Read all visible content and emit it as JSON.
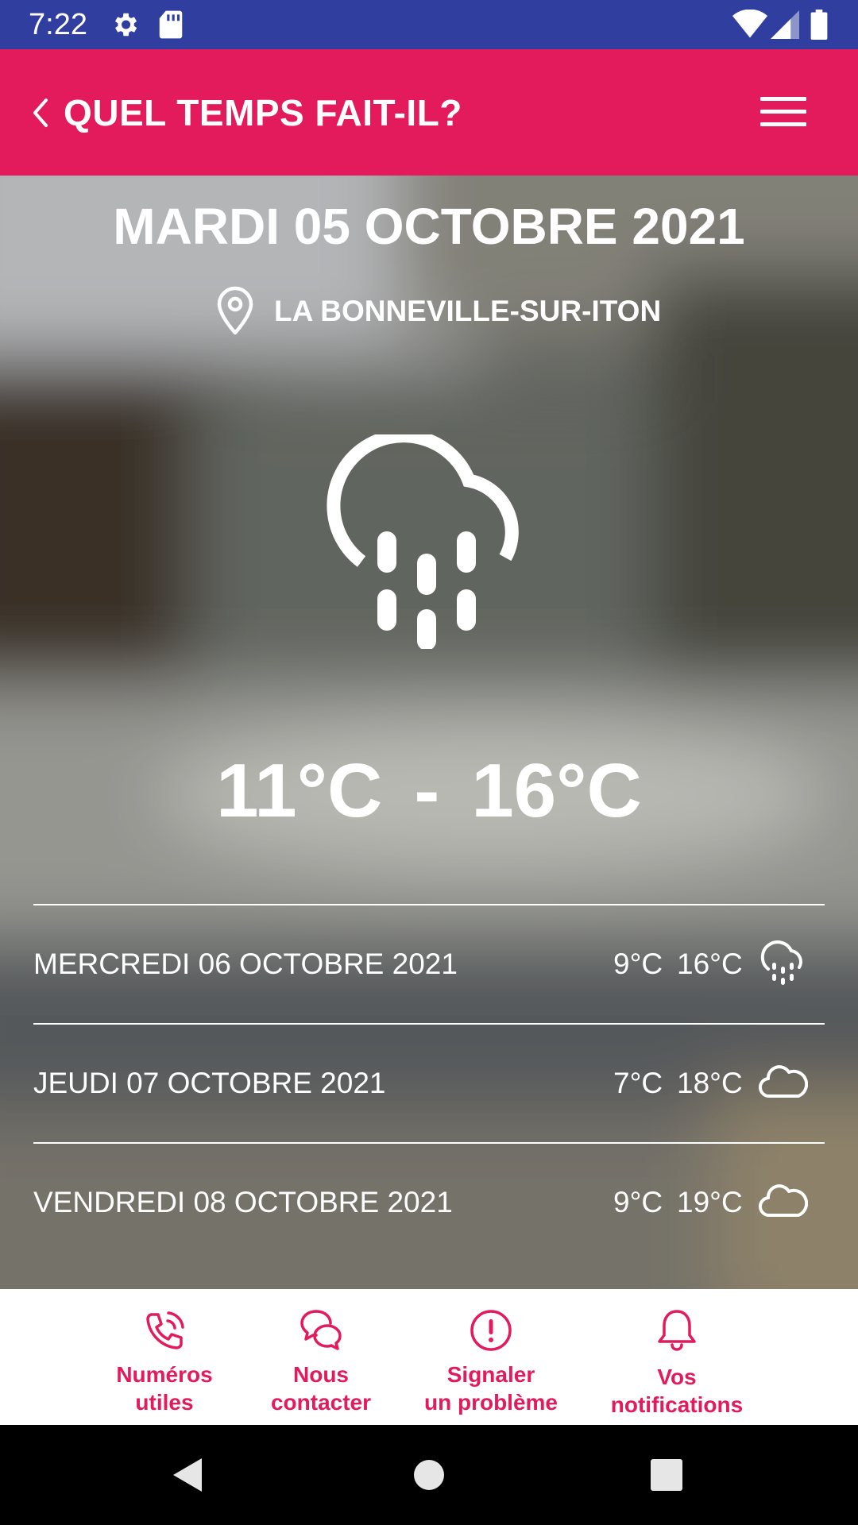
{
  "status_bar": {
    "time": "7:22"
  },
  "app_bar": {
    "title": "QUEL TEMPS FAIT-IL?"
  },
  "today": {
    "date": "MARDI 05 OCTOBRE 2021",
    "location": "LA BONNEVILLE-SUR-ITON",
    "min": "11°C",
    "max": "16°C",
    "separator": "-",
    "icon": "rain-cloud-icon"
  },
  "forecast": [
    {
      "day": "MERCREDI 06 OCTOBRE 2021",
      "min": "9°C",
      "max": "16°C",
      "icon": "rain-cloud-icon"
    },
    {
      "day": "JEUDI 07 OCTOBRE 2021",
      "min": "7°C",
      "max": "18°C",
      "icon": "cloud-icon"
    },
    {
      "day": "VENDREDI 08 OCTOBRE 2021",
      "min": "9°C",
      "max": "19°C",
      "icon": "cloud-icon"
    }
  ],
  "tabs": [
    {
      "label_line1": "Numéros",
      "label_line2": "utiles",
      "icon": "phone-icon"
    },
    {
      "label_line1": "Nous",
      "label_line2": "contacter",
      "icon": "chat-icon"
    },
    {
      "label_line1": "Signaler",
      "label_line2": "un problème",
      "icon": "alert-icon"
    },
    {
      "label_line1": "Vos",
      "label_line2": "notifications",
      "icon": "bell-icon"
    }
  ],
  "colors": {
    "accent": "#e31a5c",
    "status_bar": "#303f9f"
  }
}
